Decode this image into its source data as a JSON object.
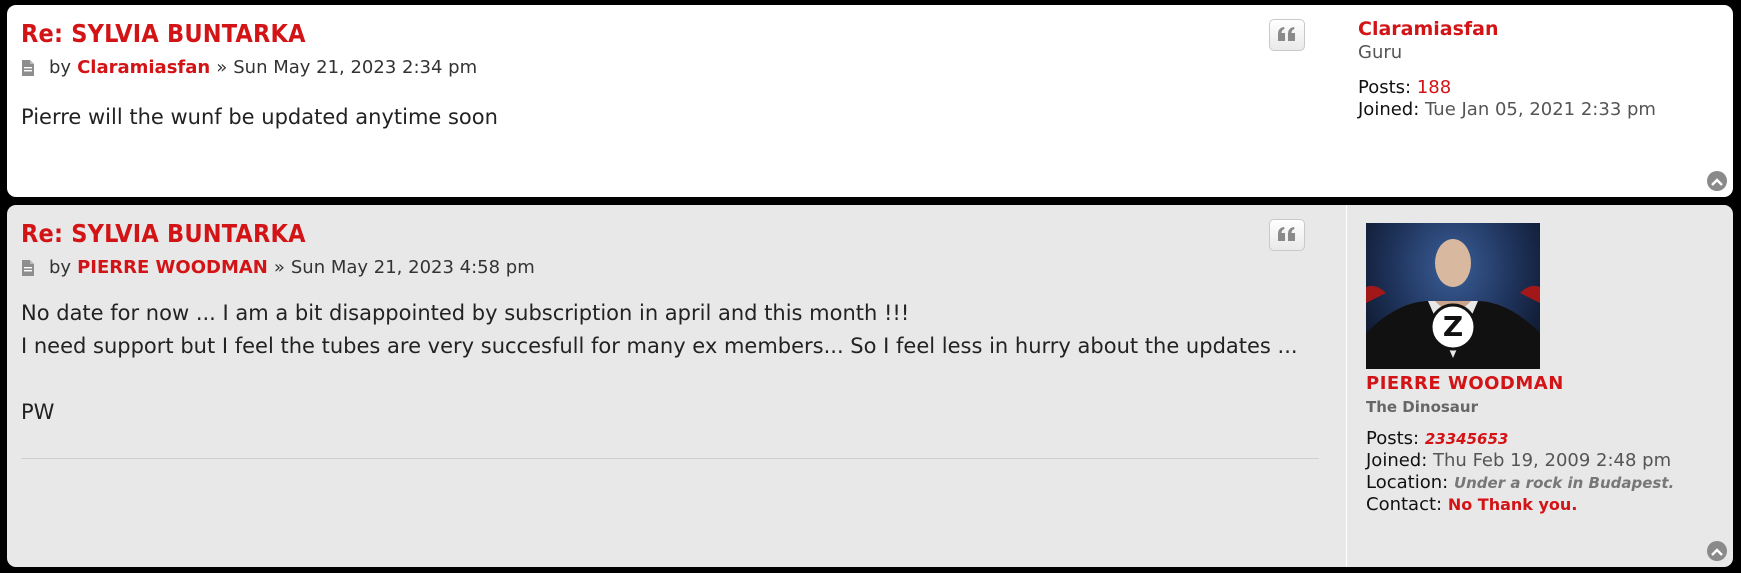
{
  "posts": [
    {
      "title": "Re: SYLVIA BUNTARKA",
      "by": "by",
      "author": "Claramiasfan",
      "sep": "»",
      "date": "Sun May 21, 2023 2:34 pm",
      "body": [
        "Pierre will the wunf be updated anytime soon"
      ],
      "profile": {
        "username": "Claramiasfan",
        "rank": "Guru",
        "posts_label": "Posts:",
        "posts_value": "188",
        "joined_label": "Joined:",
        "joined_value": "Tue Jan 05, 2021 2:33 pm"
      }
    },
    {
      "title": "Re: SYLVIA BUNTARKA",
      "by": "by",
      "author": "PIERRE WOODMAN",
      "sep": "»",
      "date": "Sun May 21, 2023 4:58 pm",
      "body": [
        "No date for now ... I am a bit disappointed by subscription in april and this month !!!",
        "I need support but I feel the tubes are very succesfull for many ex members... So I feel less in hurry about the updates ...",
        "",
        "PW"
      ],
      "profile": {
        "username": "PIERRE WOODMAN",
        "rank": "The Dinosaur",
        "posts_label": "Posts:",
        "posts_value": "23345653",
        "joined_label": "Joined:",
        "joined_value": "Thu Feb 19, 2009 2:48 pm",
        "location_label": "Location:",
        "location_value": "Under a rock in Budapest.",
        "contact_label": "Contact:",
        "contact_value": "No Thank you.",
        "avatar_letter": "Z"
      }
    }
  ],
  "icons": {
    "post": "post-page-icon",
    "quote": "quote-icon",
    "top": "back-to-top-icon"
  },
  "colors": {
    "accent": "#d31417",
    "post_bg_1": "#ffffff",
    "post_bg_2": "#e8e8e8"
  }
}
